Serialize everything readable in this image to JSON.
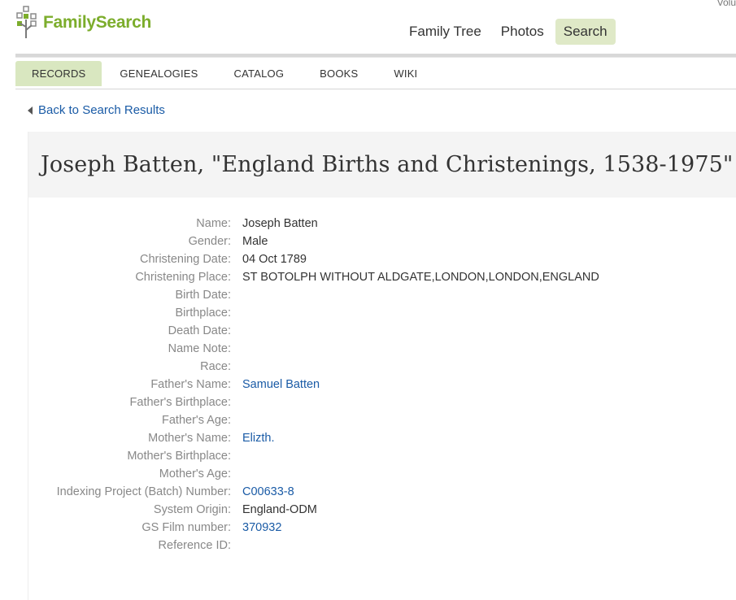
{
  "topcut": "Volu",
  "logo": {
    "text": "FamilySearch"
  },
  "mainnav": [
    {
      "label": "Family Tree",
      "active": false
    },
    {
      "label": "Photos",
      "active": false
    },
    {
      "label": "Search",
      "active": true
    }
  ],
  "subnav": [
    {
      "label": "RECORDS",
      "active": true
    },
    {
      "label": "GENEALOGIES",
      "active": false
    },
    {
      "label": "CATALOG",
      "active": false
    },
    {
      "label": "BOOKS",
      "active": false
    },
    {
      "label": "WIKI",
      "active": false
    }
  ],
  "back_link": "Back to Search Results",
  "record_title": "Joseph Batten, \"England Births and Christenings, 1538-1975\"",
  "fields": [
    {
      "label": "Name:",
      "value": "Joseph Batten",
      "link": false
    },
    {
      "label": "Gender:",
      "value": "Male",
      "link": false
    },
    {
      "label": "Christening Date:",
      "value": "04 Oct 1789",
      "link": false
    },
    {
      "label": "Christening Place:",
      "value": "ST BOTOLPH WITHOUT ALDGATE,LONDON,LONDON,ENGLAND",
      "link": false
    },
    {
      "label": "Birth Date:",
      "value": "",
      "link": false
    },
    {
      "label": "Birthplace:",
      "value": "",
      "link": false
    },
    {
      "label": "Death Date:",
      "value": "",
      "link": false
    },
    {
      "label": "Name Note:",
      "value": "",
      "link": false
    },
    {
      "label": "Race:",
      "value": "",
      "link": false
    },
    {
      "label": "Father's Name:",
      "value": "Samuel Batten",
      "link": true
    },
    {
      "label": "Father's Birthplace:",
      "value": "",
      "link": false
    },
    {
      "label": "Father's Age:",
      "value": "",
      "link": false
    },
    {
      "label": "Mother's Name:",
      "value": "Elizth.",
      "link": true
    },
    {
      "label": "Mother's Birthplace:",
      "value": "",
      "link": false
    },
    {
      "label": "Mother's Age:",
      "value": "",
      "link": false
    },
    {
      "label": "Indexing Project (Batch) Number:",
      "value": "C00633-8",
      "link": true
    },
    {
      "label": "System Origin:",
      "value": "England-ODM",
      "link": false
    },
    {
      "label": "GS Film number:",
      "value": "370932",
      "link": true
    },
    {
      "label": "Reference ID:",
      "value": "",
      "link": false
    }
  ],
  "colors": {
    "brand_green": "#7cad2c",
    "active_tab": "#dfe9c7",
    "link": "#1a5ba6"
  }
}
